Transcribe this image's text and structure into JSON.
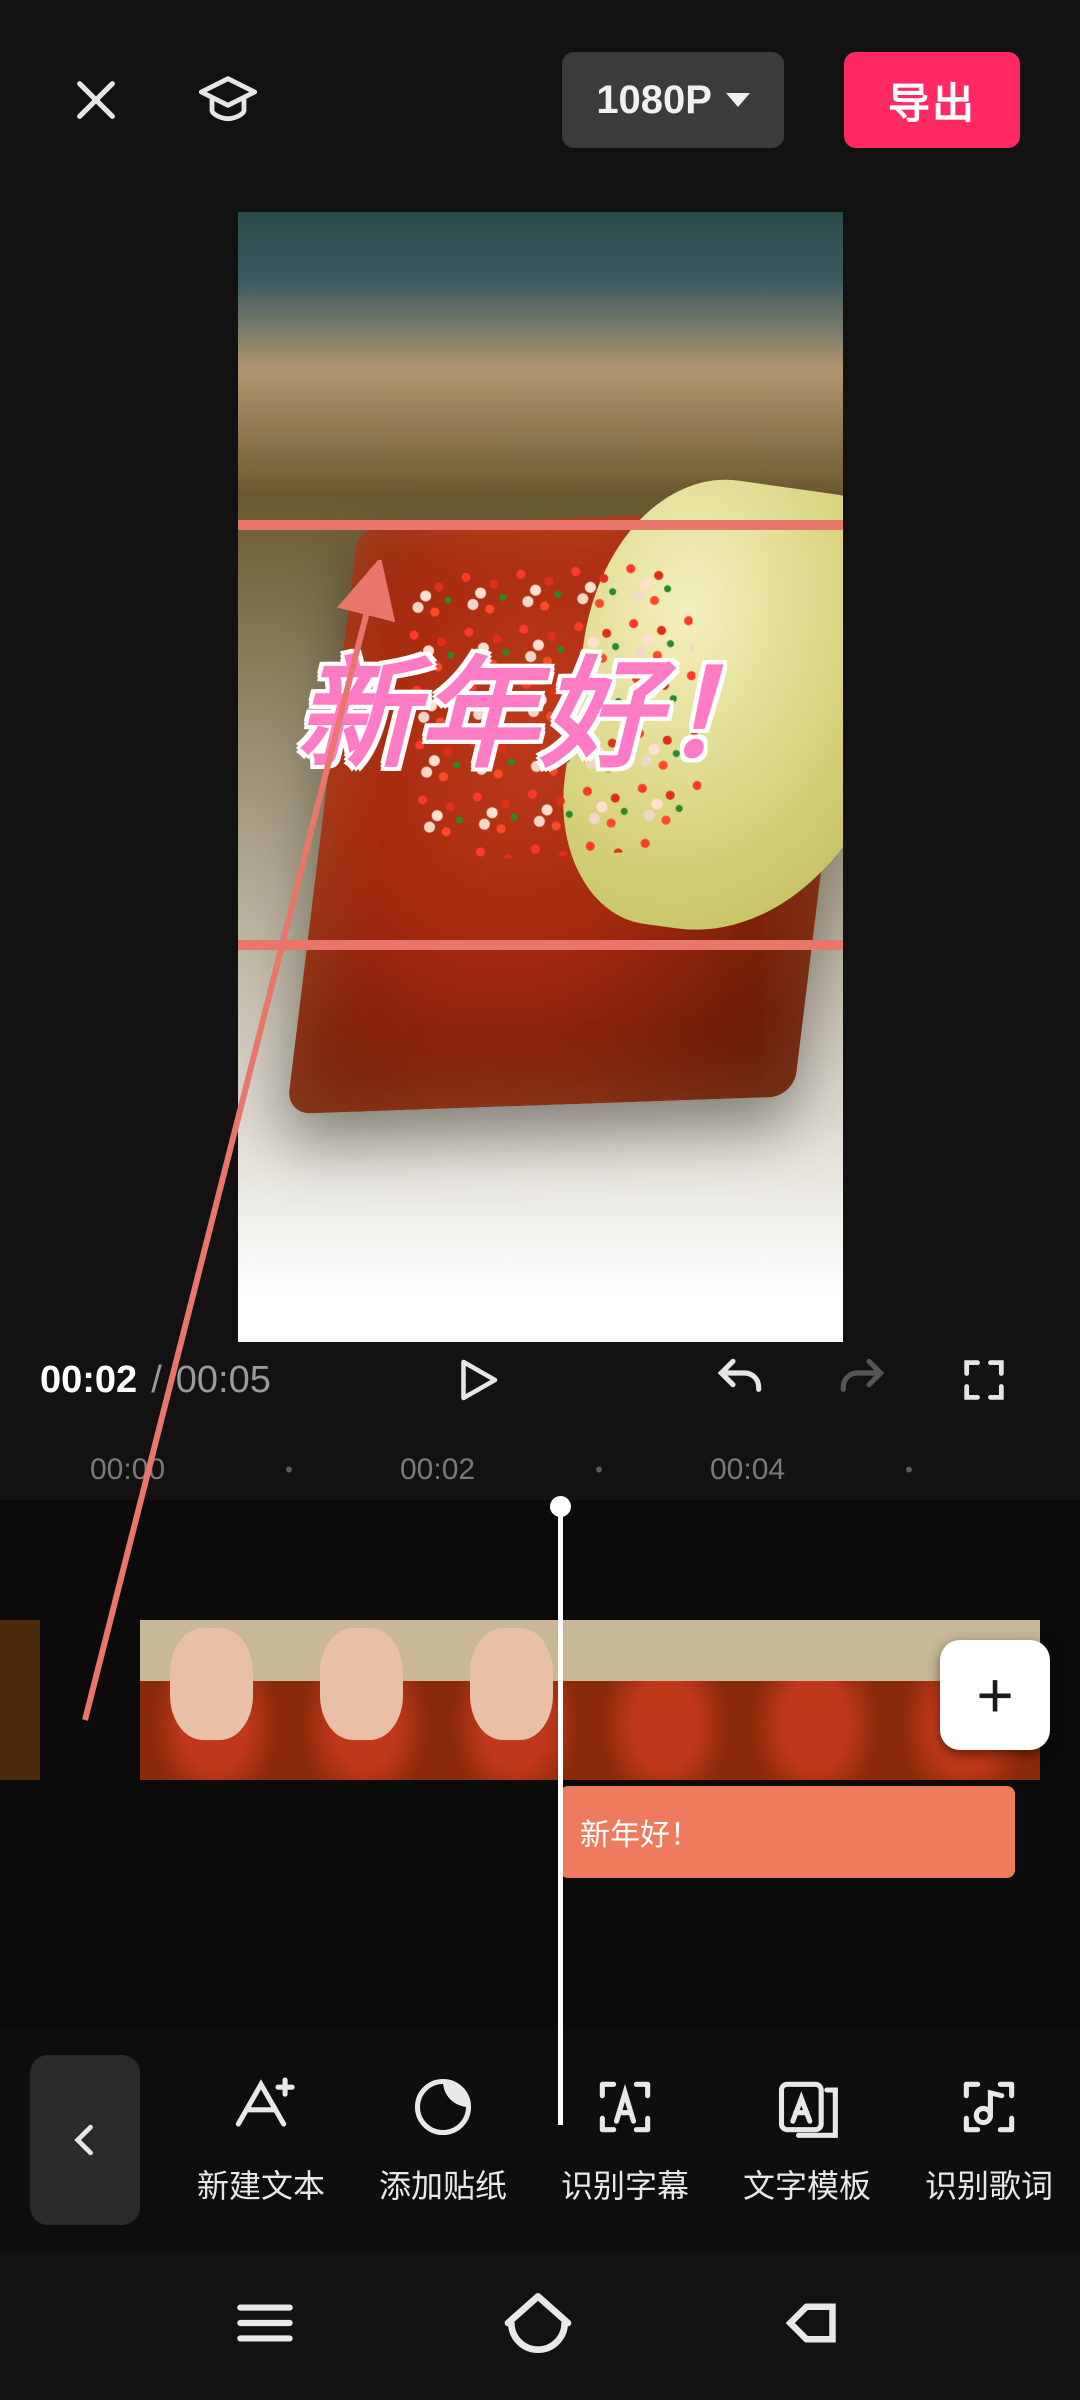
{
  "topbar": {
    "resolution": "1080P",
    "export_label": "导出"
  },
  "preview": {
    "overlay_text": "新年好！"
  },
  "playbar": {
    "current": "00:02",
    "separator": "/",
    "duration": "00:05"
  },
  "ruler": {
    "ticks": [
      "00:00",
      "00:02",
      "00:04"
    ]
  },
  "timeline": {
    "text_clip_label": "新年好！",
    "add_label": "+"
  },
  "toolbar": {
    "items": [
      {
        "icon": "new-text-icon",
        "label": "新建文本"
      },
      {
        "icon": "sticker-icon",
        "label": "添加贴纸"
      },
      {
        "icon": "subtitle-icon",
        "label": "识别字幕"
      },
      {
        "icon": "template-icon",
        "label": "文字模板"
      },
      {
        "icon": "lyrics-icon",
        "label": "识别歌词"
      }
    ]
  }
}
